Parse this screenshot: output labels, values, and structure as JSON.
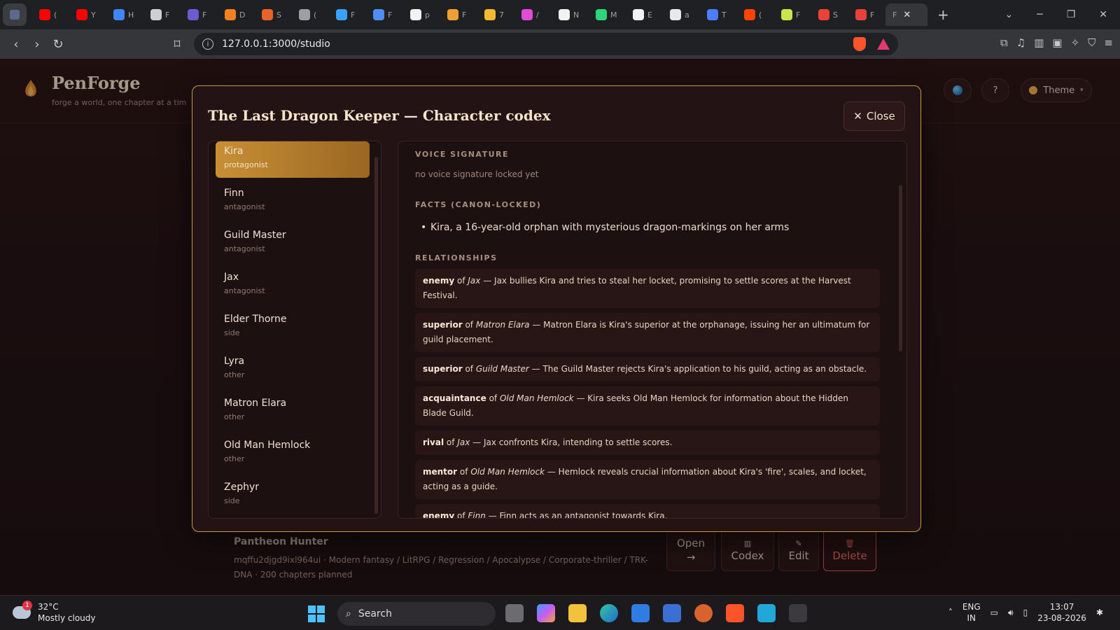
{
  "browser": {
    "url": "127.0.0.1:3000/studio",
    "tab_letters": [
      "(",
      "Y",
      "H",
      "F",
      "F",
      "D",
      "S",
      "(",
      "F",
      "F",
      "p",
      "F",
      "7",
      "/",
      "N",
      "M",
      "E",
      "a",
      "T",
      "(",
      "F",
      "S",
      "F"
    ],
    "active_tab_letter": "F",
    "colors": {
      "tabbar": "#1f2023",
      "toolbar": "#35363a"
    }
  },
  "app": {
    "brand": "PenForge",
    "tagline": "forge a world, one chapter at a tim",
    "help_label": "?",
    "theme_label": "Theme"
  },
  "project": {
    "title": "Pantheon Hunter",
    "meta": "mqffu2djgd9ixl964ui · Modern fantasy / LitRPG / Regression / Apocalypse / Corporate-thriller / TRK-DNA · 200 chapters planned",
    "actions": {
      "open": "Open",
      "open_arrow": "→",
      "codex": "Codex",
      "edit": "Edit",
      "delete": "Delete"
    }
  },
  "modal": {
    "title": "The Last Dragon Keeper — Character codex",
    "close_label": "Close",
    "characters": [
      {
        "name": "Kira",
        "role": "protagonist",
        "selected": true
      },
      {
        "name": "Finn",
        "role": "antagonist"
      },
      {
        "name": "Guild Master",
        "role": "antagonist"
      },
      {
        "name": "Jax",
        "role": "antagonist"
      },
      {
        "name": "Elder Thorne",
        "role": "side"
      },
      {
        "name": "Lyra",
        "role": "other"
      },
      {
        "name": "Matron Elara",
        "role": "other"
      },
      {
        "name": "Old Man Hemlock",
        "role": "other"
      },
      {
        "name": "Zephyr",
        "role": "side"
      }
    ],
    "detail": {
      "voice_label": "VOICE SIGNATURE",
      "voice_value": "no voice signature locked yet",
      "facts_label": "FACTS (CANON-LOCKED)",
      "facts": [
        "Kira, a 16-year-old orphan with mysterious dragon-markings on her arms"
      ],
      "relationships_label": "RELATIONSHIPS",
      "relationships": [
        {
          "type": "enemy",
          "of": "of",
          "target": "Jax",
          "text": "— Jax bullies Kira and tries to steal her locket, promising to settle scores at the Harvest Festival."
        },
        {
          "type": "superior",
          "of": "of",
          "target": "Matron Elara",
          "text": "— Matron Elara is Kira's superior at the orphanage, issuing her an ultimatum for guild placement."
        },
        {
          "type": "superior",
          "of": "of",
          "target": "Guild Master",
          "text": "— The Guild Master rejects Kira's application to his guild, acting as an obstacle."
        },
        {
          "type": "acquaintance",
          "of": "of",
          "target": "Old Man Hemlock",
          "text": "— Kira seeks Old Man Hemlock for information about the Hidden Blade Guild."
        },
        {
          "type": "rival",
          "of": "of",
          "target": "Jax",
          "text": "— Jax confronts Kira, intending to settle scores."
        },
        {
          "type": "mentor",
          "of": "of",
          "target": "Old Man Hemlock",
          "text": "— Hemlock reveals crucial information about Kira's 'fire', scales, and locket, acting as a guide."
        },
        {
          "type": "enemy",
          "of": "of",
          "target": "Finn",
          "text": "— Finn acts as an antagonist towards Kira."
        }
      ]
    },
    "colors": {
      "accent": "#c99a3c",
      "selected": "#c88f35"
    }
  },
  "taskbar": {
    "temperature": "32°C",
    "condition": "Mostly cloudy",
    "notification_count": "1",
    "search_placeholder": "Search",
    "lang_top": "ENG",
    "lang_bottom": "IN",
    "time": "13:07",
    "date": "23-08-2026"
  }
}
